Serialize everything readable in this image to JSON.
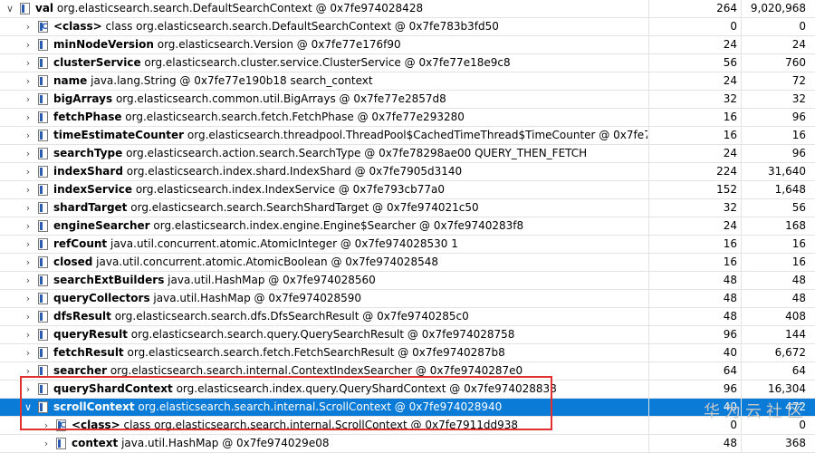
{
  "rows": [
    {
      "level": 0,
      "arrow": "v",
      "icon": "field",
      "name": "val",
      "type": "org.elasticsearch.search.DefaultSearchContext @ 0x7fe974028428",
      "value": "",
      "shallow": "264",
      "retained": "9,020,968"
    },
    {
      "level": 1,
      "arrow": ">",
      "icon": "class",
      "name": "<class>",
      "type": "class org.elasticsearch.search.DefaultSearchContext @ 0x7fe783b3fd50",
      "value": "",
      "shallow": "0",
      "retained": "0"
    },
    {
      "level": 1,
      "arrow": ">",
      "icon": "field",
      "name": "minNodeVersion",
      "type": "org.elasticsearch.Version @ 0x7fe77e176f90",
      "value": "",
      "shallow": "24",
      "retained": "24"
    },
    {
      "level": 1,
      "arrow": ">",
      "icon": "field",
      "name": "clusterService",
      "type": "org.elasticsearch.cluster.service.ClusterService @ 0x7fe77e18e9c8",
      "value": "",
      "shallow": "56",
      "retained": "760"
    },
    {
      "level": 1,
      "arrow": ">",
      "icon": "field",
      "name": "name",
      "type": "java.lang.String @ 0x7fe77e190b18",
      "value": "search_context",
      "shallow": "24",
      "retained": "72"
    },
    {
      "level": 1,
      "arrow": ">",
      "icon": "field",
      "name": "bigArrays",
      "type": "org.elasticsearch.common.util.BigArrays @ 0x7fe77e2857d8",
      "value": "",
      "shallow": "32",
      "retained": "32"
    },
    {
      "level": 1,
      "arrow": ">",
      "icon": "field",
      "name": "fetchPhase",
      "type": "org.elasticsearch.search.fetch.FetchPhase @ 0x7fe77e293280",
      "value": "",
      "shallow": "16",
      "retained": "96"
    },
    {
      "level": 1,
      "arrow": ">",
      "icon": "field",
      "name": "timeEstimateCounter",
      "type": "org.elasticsearch.threadpool.ThreadPool$CachedTimeThread$TimeCounter @ 0x7fe77f2938a0",
      "value": "",
      "shallow": "16",
      "retained": "16"
    },
    {
      "level": 1,
      "arrow": ">",
      "icon": "field",
      "name": "searchType",
      "type": "org.elasticsearch.action.search.SearchType @ 0x7fe78298ae00",
      "value": "QUERY_THEN_FETCH",
      "shallow": "24",
      "retained": "96"
    },
    {
      "level": 1,
      "arrow": ">",
      "icon": "field",
      "name": "indexShard",
      "type": "org.elasticsearch.index.shard.IndexShard @ 0x7fe7905d3140",
      "value": "",
      "shallow": "224",
      "retained": "31,640"
    },
    {
      "level": 1,
      "arrow": ">",
      "icon": "field",
      "name": "indexService",
      "type": "org.elasticsearch.index.IndexService @ 0x7fe793cb77a0",
      "value": "",
      "shallow": "152",
      "retained": "1,648"
    },
    {
      "level": 1,
      "arrow": ">",
      "icon": "field",
      "name": "shardTarget",
      "type": "org.elasticsearch.search.SearchShardTarget @ 0x7fe974021c50",
      "value": "",
      "shallow": "32",
      "retained": "56"
    },
    {
      "level": 1,
      "arrow": ">",
      "icon": "field",
      "name": "engineSearcher",
      "type": "org.elasticsearch.index.engine.Engine$Searcher @ 0x7fe9740283f8",
      "value": "",
      "shallow": "24",
      "retained": "168"
    },
    {
      "level": 1,
      "arrow": ">",
      "icon": "field",
      "name": "refCount",
      "type": "java.util.concurrent.atomic.AtomicInteger @ 0x7fe974028530",
      "value": "1",
      "shallow": "16",
      "retained": "16"
    },
    {
      "level": 1,
      "arrow": ">",
      "icon": "field",
      "name": "closed",
      "type": "java.util.concurrent.atomic.AtomicBoolean @ 0x7fe974028548",
      "value": "",
      "shallow": "16",
      "retained": "16"
    },
    {
      "level": 1,
      "arrow": ">",
      "icon": "field",
      "name": "searchExtBuilders",
      "type": "java.util.HashMap @ 0x7fe974028560",
      "value": "",
      "shallow": "48",
      "retained": "48"
    },
    {
      "level": 1,
      "arrow": ">",
      "icon": "field",
      "name": "queryCollectors",
      "type": "java.util.HashMap @ 0x7fe974028590",
      "value": "",
      "shallow": "48",
      "retained": "48"
    },
    {
      "level": 1,
      "arrow": ">",
      "icon": "field",
      "name": "dfsResult",
      "type": "org.elasticsearch.search.dfs.DfsSearchResult @ 0x7fe9740285c0",
      "value": "",
      "shallow": "48",
      "retained": "408"
    },
    {
      "level": 1,
      "arrow": ">",
      "icon": "field",
      "name": "queryResult",
      "type": "org.elasticsearch.search.query.QuerySearchResult @ 0x7fe974028758",
      "value": "",
      "shallow": "96",
      "retained": "144"
    },
    {
      "level": 1,
      "arrow": ">",
      "icon": "field",
      "name": "fetchResult",
      "type": "org.elasticsearch.search.fetch.FetchSearchResult @ 0x7fe9740287b8",
      "value": "",
      "shallow": "40",
      "retained": "6,672"
    },
    {
      "level": 1,
      "arrow": ">",
      "icon": "field",
      "name": "searcher",
      "type": "org.elasticsearch.search.internal.ContextIndexSearcher @ 0x7fe9740287e0",
      "value": "",
      "shallow": "64",
      "retained": "64"
    },
    {
      "level": 1,
      "arrow": ">",
      "icon": "field",
      "name": "queryShardContext",
      "type": "org.elasticsearch.index.query.QueryShardContext @ 0x7fe974028838",
      "value": "",
      "shallow": "96",
      "retained": "16,304"
    },
    {
      "level": 1,
      "arrow": "v",
      "icon": "field",
      "name": "scrollContext",
      "type": "org.elasticsearch.search.internal.ScrollContext @ 0x7fe974028940",
      "value": "",
      "shallow": "40",
      "retained": "472",
      "selected": true
    },
    {
      "level": 2,
      "arrow": ">",
      "icon": "class",
      "name": "<class>",
      "type": "class org.elasticsearch.search.internal.ScrollContext @ 0x7fe7911dd938",
      "value": "",
      "shallow": "0",
      "retained": "0"
    },
    {
      "level": 2,
      "arrow": ">",
      "icon": "field",
      "name": "context",
      "type": "java.util.HashMap @ 0x7fe974029e08",
      "value": "",
      "shallow": "48",
      "retained": "368"
    }
  ],
  "watermark": "华为云社区"
}
